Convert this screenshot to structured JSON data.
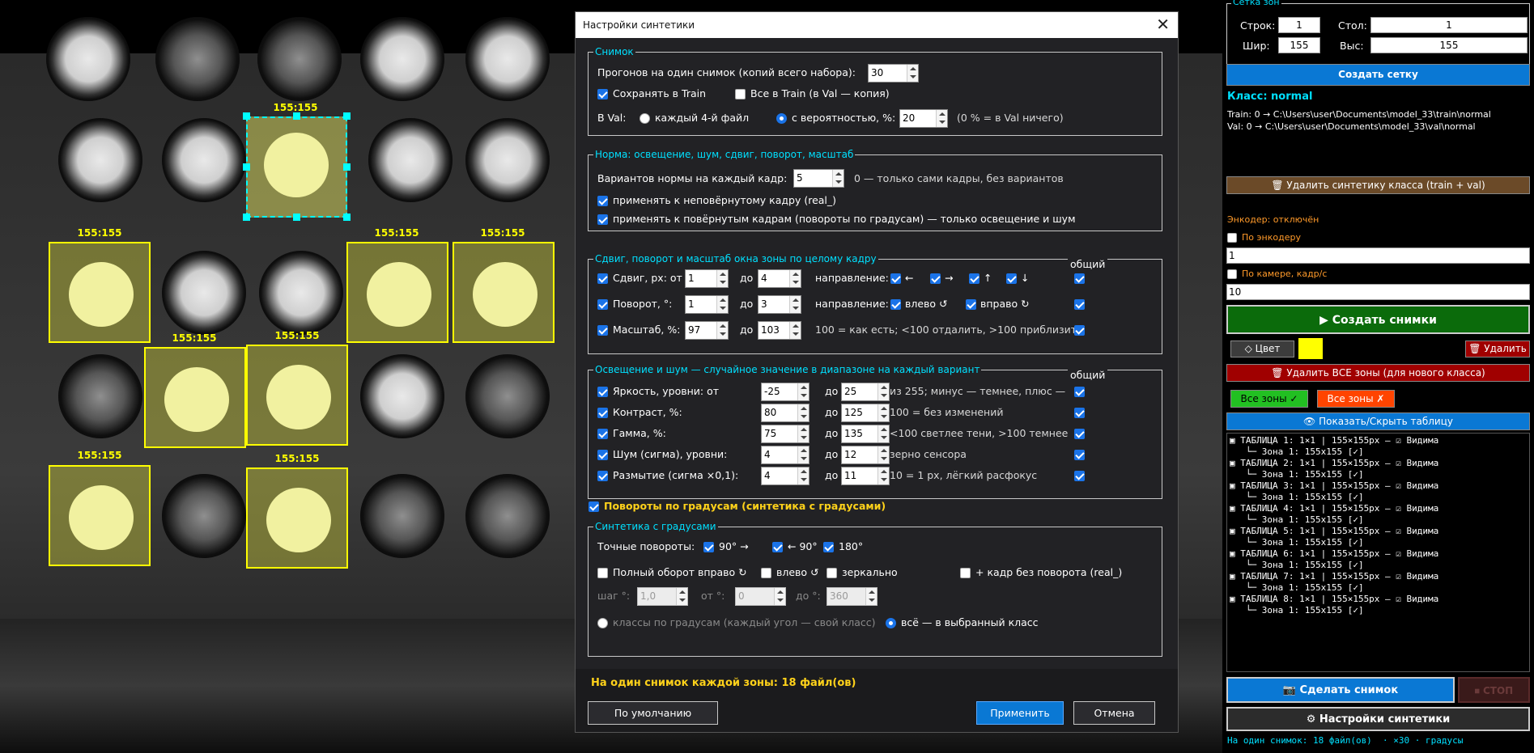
{
  "camera": {
    "zone_label": "155:155",
    "zone_labels": [
      "155:155",
      "155:155",
      "155:155",
      "155:155",
      "155:155",
      "155:155",
      "155:155",
      "155:155"
    ]
  },
  "dialog": {
    "title": "Настройки синтетики",
    "close_glyph": "✕",
    "snapshot": {
      "title": "Снимок",
      "runs_label": "Прогонов на один снимок (копий всего набора):",
      "runs_value": "30",
      "save_train_label": "Сохранять в Train",
      "save_train_checked": true,
      "all_train_label": "Все в Train (в Val — копия)",
      "all_train_checked": false,
      "val_label": "В Val:",
      "every4_label": "каждый 4-й файл",
      "prob_label": "с вероятностью, %:",
      "prob_value": "20",
      "prob_note": "(0 % = в Val ничего)"
    },
    "norm": {
      "title": "Норма: освещение, шум, сдвиг, поворот, масштаб",
      "variants_label": "Вариантов нормы на каждый кадр:",
      "variants_value": "5",
      "variants_note": "0 — только сами кадры, без вариантов",
      "apply_unrotated": "применять к неповёрнутому кадру (real_)",
      "apply_rotated": "применять к повёрнутым кадрам (повороты по градусам) — только освещение и шум"
    },
    "shift": {
      "title": "Сдвиг, поворот и масштаб окна зоны по целому кадру",
      "common_label": "общий",
      "shift_label": "Сдвиг, px: от",
      "shift_from": "1",
      "shift_to": "4",
      "to_label": "до",
      "direction_label": "направление:",
      "dir_left": "←",
      "dir_right": "→",
      "dir_up": "↑",
      "dir_down": "↓",
      "rot_label": "Поворот, °:",
      "rot_from": "1",
      "rot_to": "3",
      "rot_left": "влево ↺",
      "rot_right": "вправо ↻",
      "scale_label": "Масштаб, %:",
      "scale_from": "97",
      "scale_to": "103",
      "scale_note": "100 = как есть; <100 отдалить, >100 приблизить"
    },
    "light": {
      "title": "Освещение и шум — случайное значение в диапазоне на каждый вариант",
      "common_label": "общий",
      "to_label": "до",
      "rows": [
        {
          "label": "Яркость, уровни: от",
          "from": "-25",
          "to": "25",
          "note": "из 255; минус — темнее, плюс —"
        },
        {
          "label": "Контраст, %:",
          "from": "80",
          "to": "125",
          "note": "100 = без изменений"
        },
        {
          "label": "Гамма, %:",
          "from": "75",
          "to": "135",
          "note": "<100 светлее тени, >100 темнее"
        },
        {
          "label": "Шум (сигма), уровни:",
          "from": "4",
          "to": "12",
          "note": "зерно сенсора"
        },
        {
          "label": "Размытие (сигма ×0,1):",
          "from": "4",
          "to": "11",
          "note": "10 = 1 px, лёгкий расфокус"
        }
      ]
    },
    "rotations_toggle": "Повороты по градусам (синтетика с градусами)",
    "degrees": {
      "title": "Синтетика с градусами",
      "exact_label": "Точные повороты:",
      "r90cw": "90° →",
      "r90ccw": "← 90°",
      "r180": "180°",
      "full_right": "Полный оборот вправо ↻",
      "left": "влево ↺",
      "mirror": "зеркально",
      "plus_real": "+ кадр без поворота (real_)",
      "step_label": "шаг °:",
      "step_value": "1,0",
      "from_label": "от °:",
      "from_value": "0",
      "to_label": "до °:",
      "to_value": "360",
      "classes_by_deg": "классы по градусам (каждый угол — свой класс)",
      "all_in_class": "всё — в выбранный класс"
    },
    "summary": "На один снимок каждой зоны: 18 файл(ов)",
    "default_btn": "По умолчанию",
    "apply_btn": "Применить",
    "cancel_btn": "Отмена"
  },
  "panel": {
    "grid_title": "Сетка зон",
    "rows_label": "Строк:",
    "rows_value": "1",
    "cols_label": "Стол:",
    "cols_value": "1",
    "width_label": "Шир:",
    "width_value": "155",
    "height_label": "Выс:",
    "height_value": "155",
    "create_grid": "Создать сетку",
    "class_label": "Класс: normal",
    "train_path": "Train: 0  →  C:\\Users\\user\\Documents\\model_33\\train\\normal",
    "val_path": "Val:  0  →  C:\\Users\\user\\Documents\\model_33\\val\\normal",
    "delete_synth": "🗑 Удалить синтетику класса (train + val)",
    "encoder_status": "Энкодер: отключён",
    "by_encoder": "По энкодеру",
    "encoder_value": "1",
    "by_camera": "По камере, кадр/с",
    "camera_value": "10",
    "create_shots": "▶ Создать снимки",
    "color_btn": "◇ Цвет",
    "delete_btn": "🗑 Удалить",
    "delete_all_zones": "🗑 Удалить ВСЕ зоны (для нового класса)",
    "all_zones_on": "Все зоны ✓",
    "all_zones_off": "Все зоны ✗",
    "toggle_table": "👁 Показать/Скрыть таблицу",
    "tables": [
      {
        "t": "▣ ТАБЛИЦА 1: 1×1 | 155×155px — ☑ Видима",
        "z": "   └─ Зона 1: 155x155 [✓]"
      },
      {
        "t": "▣ ТАБЛИЦА 2: 1×1 | 155×155px — ☑ Видима",
        "z": "   └─ Зона 1: 155x155 [✓]"
      },
      {
        "t": "▣ ТАБЛИЦА 3: 1×1 | 155×155px — ☑ Видима",
        "z": "   └─ Зона 1: 155x155 [✓]"
      },
      {
        "t": "▣ ТАБЛИЦА 4: 1×1 | 155×155px — ☑ Видима",
        "z": "   └─ Зона 1: 155x155 [✓]"
      },
      {
        "t": "▣ ТАБЛИЦА 5: 1×1 | 155×155px — ☑ Видима",
        "z": "   └─ Зона 1: 155x155 [✓]"
      },
      {
        "t": "▣ ТАБЛИЦА 6: 1×1 | 155×155px — ☑ Видима",
        "z": "   └─ Зона 1: 155x155 [✓]"
      },
      {
        "t": "▣ ТАБЛИЦА 7: 1×1 | 155×155px — ☑ Видима",
        "z": "   └─ Зона 1: 155x155 [✓]"
      },
      {
        "t": "▣ ТАБЛИЦА 8: 1×1 | 155×155px — ☑ Видима",
        "z": "   └─ Зона 1: 155x155 [✓]"
      }
    ],
    "take_shot": "📷 Сделать снимок",
    "stop": "⏹ СТОП",
    "synth_settings": "⚙ Настройки синтетики",
    "status": "На один снимок: 18 файл(ов)  · ×30 · градусы",
    "colors": {
      "accent": "#0a78d4",
      "green": "#0b6b0b",
      "red": "#a00000",
      "yellow": "#ffff00",
      "cyan": "#00e0ff",
      "brown": "#6b4a28"
    }
  }
}
